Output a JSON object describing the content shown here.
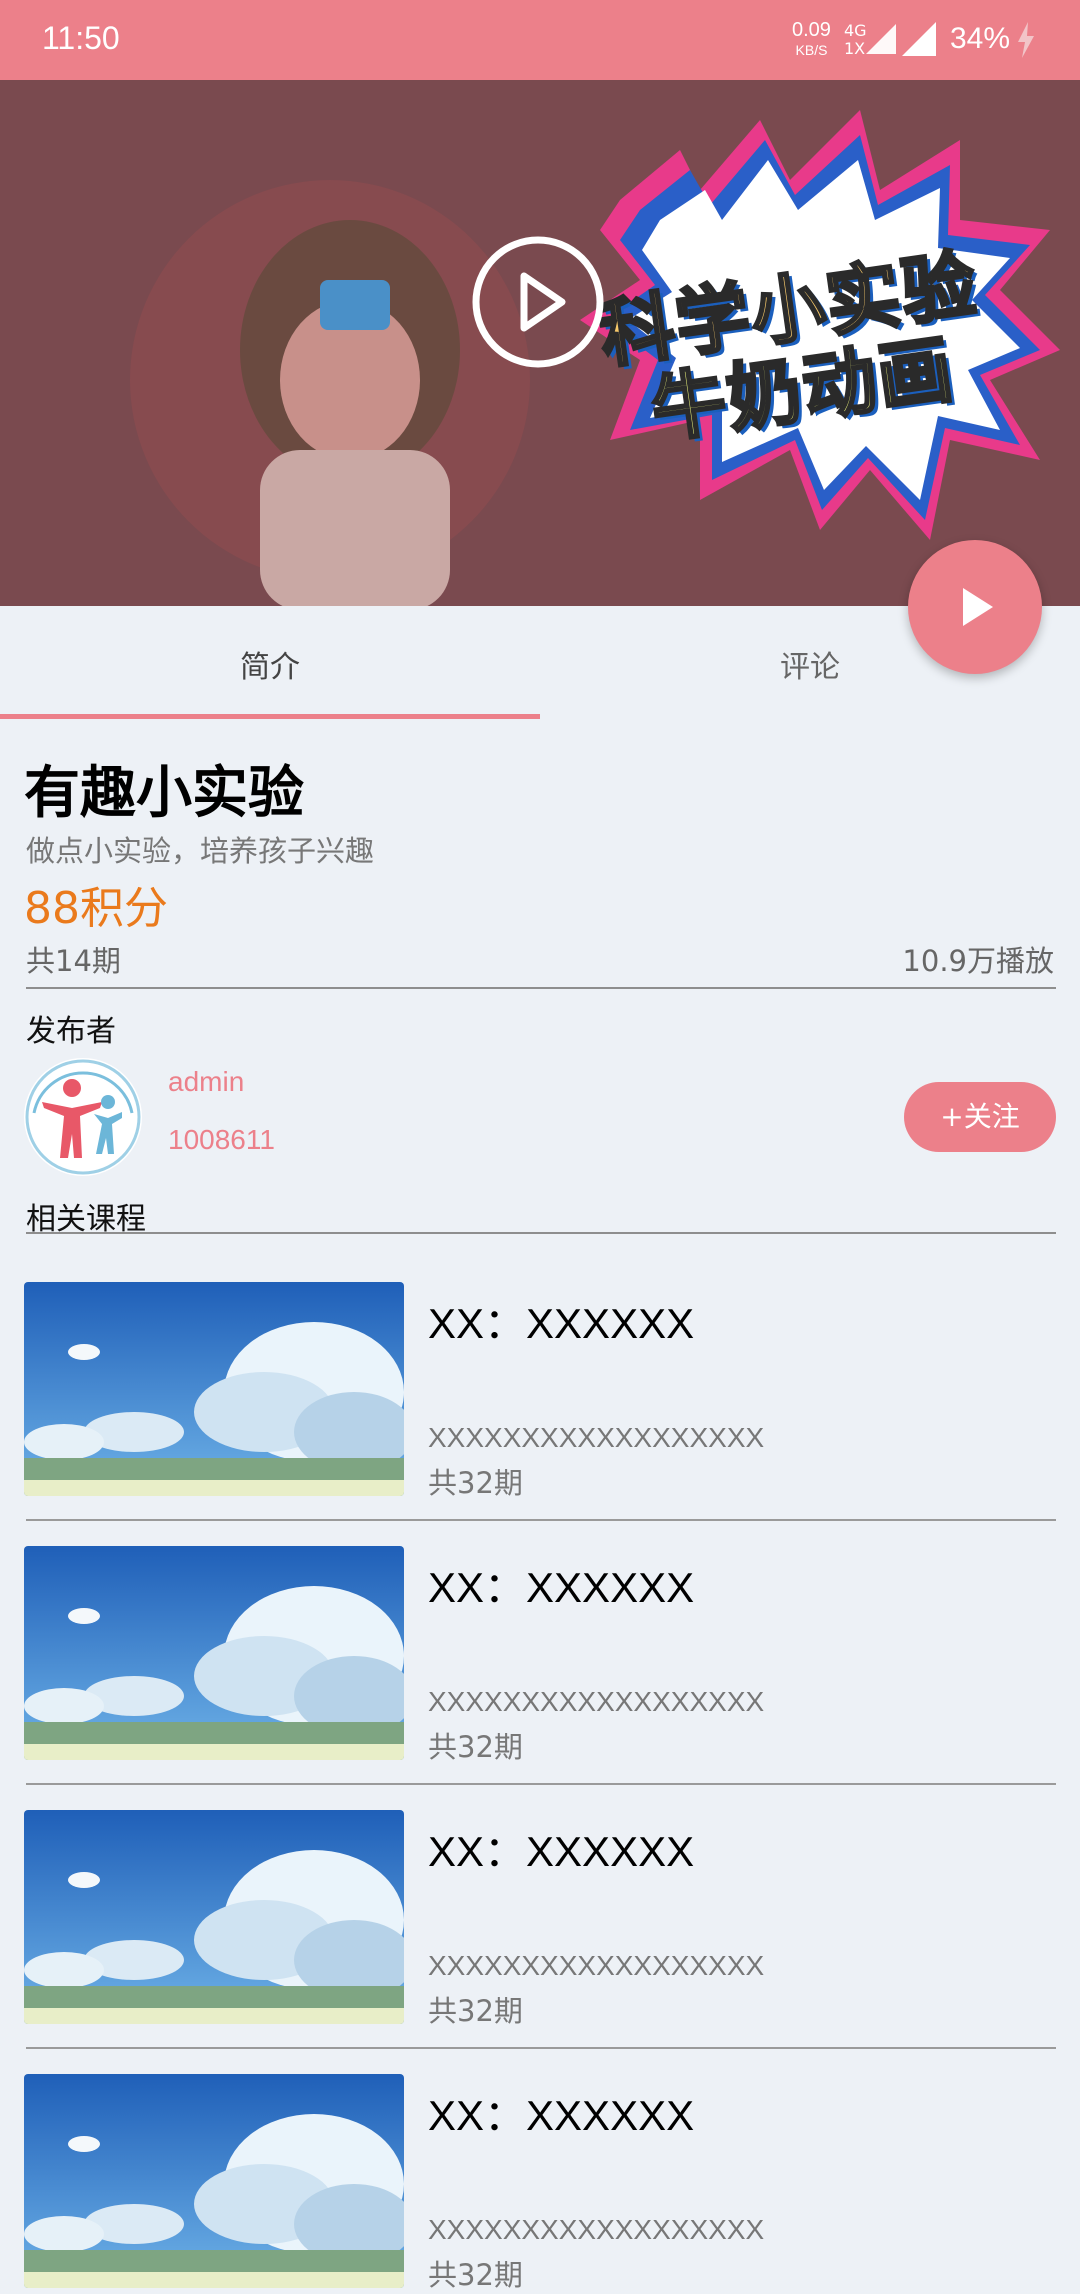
{
  "status_bar": {
    "time": "11:50",
    "net_speed": "0.09",
    "net_speed_unit": "KB/S",
    "network_type_top": "4G",
    "network_type_bottom": "1X",
    "battery": "34%"
  },
  "video": {
    "banner_line1": "科学小实验",
    "banner_line2": "牛奶动画",
    "play_icon": "play-circle-icon"
  },
  "fab": {
    "icon": "play-icon"
  },
  "tabs": [
    {
      "label": "简介",
      "active": true
    },
    {
      "label": "评论",
      "active": false
    }
  ],
  "course": {
    "title": "有趣小实验",
    "subtitle": "做点小实验，培养孩子兴趣",
    "points": "88积分",
    "episodes": "共14期",
    "plays": "10.9万播放"
  },
  "publisher": {
    "section_label": "发布者",
    "name": "admin",
    "id": "1008611",
    "follow_label": "+关注"
  },
  "related": {
    "section_label": "相关课程",
    "items": [
      {
        "title": "XX：XXXXXX",
        "description": "XXXXXXXXXXXXXXXXXX",
        "episodes": "共32期"
      },
      {
        "title": "XX：XXXXXX",
        "description": "XXXXXXXXXXXXXXXXXX",
        "episodes": "共32期"
      },
      {
        "title": "XX：XXXXXX",
        "description": "XXXXXXXXXXXXXXXXXX",
        "episodes": "共32期"
      },
      {
        "title": "XX：XXXXXX",
        "description": "XXXXXXXXXXXXXXXXXX",
        "episodes": "共32期"
      }
    ]
  },
  "colors": {
    "accent": "#ec808a",
    "points": "#ea7a1c",
    "background": "#edf1f6"
  }
}
